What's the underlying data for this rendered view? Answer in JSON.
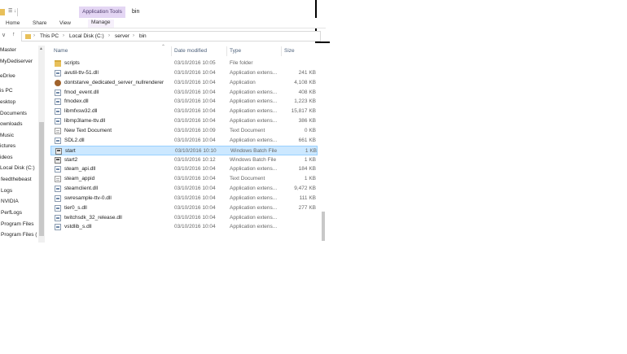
{
  "window": {
    "title": "bin",
    "context_tab": "Application Tools",
    "quick_access": "☰ ↓"
  },
  "ribbon": {
    "tabs": [
      "Home",
      "Share",
      "View",
      "Manage"
    ]
  },
  "nav": {
    "back": "←",
    "forward": "→",
    "recent": "∨",
    "up": "↑"
  },
  "address": {
    "crumbs": [
      "This PC",
      "Local Disk (C:)",
      "server",
      "bin"
    ],
    "separator": "›"
  },
  "sidebar": {
    "items": [
      "Master",
      "MyDediserver",
      "eDrive",
      "is PC",
      "esktop",
      "Documents",
      "ownloads",
      "Music",
      "ictures",
      "ideos",
      "Local Disk (C:)",
      "feedthebeast",
      "Logs",
      "NVIDIA",
      "PerfLogs",
      "Program Files",
      "Program Files ("
    ]
  },
  "columns": {
    "name": "Name",
    "date": "Date modified",
    "type": "Type",
    "size": "Size"
  },
  "files": [
    {
      "name": "scripts",
      "date": "03/10/2016 10:05",
      "type": "File folder",
      "size": "",
      "icon": "folder"
    },
    {
      "name": "avutil-ttv-51.dll",
      "date": "03/10/2016 10:04",
      "type": "Application extens...",
      "size": "241 KB",
      "icon": "dll"
    },
    {
      "name": "dontstarve_dedicated_server_nullrenderer",
      "date": "03/10/2016 10:04",
      "type": "Application",
      "size": "4,108 KB",
      "icon": "exe"
    },
    {
      "name": "fmod_event.dll",
      "date": "03/10/2016 10:04",
      "type": "Application extens...",
      "size": "408 KB",
      "icon": "dll"
    },
    {
      "name": "fmodex.dll",
      "date": "03/10/2016 10:04",
      "type": "Application extens...",
      "size": "1,223 KB",
      "icon": "dll"
    },
    {
      "name": "libmfxsw32.dll",
      "date": "03/10/2016 10:04",
      "type": "Application extens...",
      "size": "15,817 KB",
      "icon": "dll"
    },
    {
      "name": "libmp3lame-ttv.dll",
      "date": "03/10/2016 10:04",
      "type": "Application extens...",
      "size": "386 KB",
      "icon": "dll"
    },
    {
      "name": "New Text Document",
      "date": "03/10/2016 10:09",
      "type": "Text Document",
      "size": "0 KB",
      "icon": "txt"
    },
    {
      "name": "SDL2.dll",
      "date": "03/10/2016 10:04",
      "type": "Application extens...",
      "size": "661 KB",
      "icon": "dll"
    },
    {
      "name": "start",
      "date": "03/10/2016 10:10",
      "type": "Windows Batch File",
      "size": "1 KB",
      "icon": "bat",
      "selected": true
    },
    {
      "name": "start2",
      "date": "03/10/2016 10:12",
      "type": "Windows Batch File",
      "size": "1 KB",
      "icon": "bat"
    },
    {
      "name": "steam_api.dll",
      "date": "03/10/2016 10:04",
      "type": "Application extens...",
      "size": "184 KB",
      "icon": "dll"
    },
    {
      "name": "steam_appid",
      "date": "03/10/2016 10:04",
      "type": "Text Document",
      "size": "1 KB",
      "icon": "txt"
    },
    {
      "name": "steamclient.dll",
      "date": "03/10/2016 10:04",
      "type": "Application extens...",
      "size": "9,472 KB",
      "icon": "dll"
    },
    {
      "name": "swresample-ttv-0.dll",
      "date": "03/10/2016 10:04",
      "type": "Application extens...",
      "size": "111 KB",
      "icon": "dll"
    },
    {
      "name": "tier0_s.dll",
      "date": "03/10/2016 10:04",
      "type": "Application extens...",
      "size": "277 KB",
      "icon": "dll"
    },
    {
      "name": "twitchsdk_32_release.dll",
      "date": "03/10/2016 10:04",
      "type": "Application extens...",
      "size": "",
      "icon": "dll"
    },
    {
      "name": "vstdlib_s.dll",
      "date": "03/10/2016 10:04",
      "type": "Application extens...",
      "size": "",
      "icon": "dll"
    }
  ],
  "colors": {
    "selection_bg": "#cce8ff",
    "context_tab_bg": "#e4d6f4",
    "folder": "#e8c05a"
  }
}
